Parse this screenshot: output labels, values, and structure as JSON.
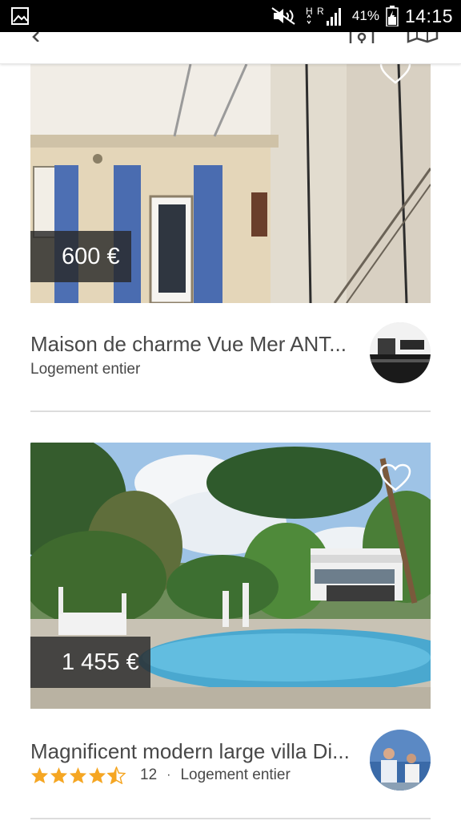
{
  "status_bar": {
    "battery_percent": "41%",
    "time": "14:15",
    "network_label": "H R"
  },
  "app_bar": {
    "icons": [
      "back-icon",
      "filter-icon",
      "map-icon"
    ]
  },
  "listings": [
    {
      "price": "600 €",
      "title": "Maison de charme Vue Mer ANT...",
      "type": "Logement entier",
      "favorited": false
    },
    {
      "price": "1 455 €",
      "title": "Magnificent modern large villa Di...",
      "rating": 4.5,
      "review_count": "12",
      "separator": "·",
      "type": "Logement entier",
      "favorited": false
    }
  ],
  "colors": {
    "star": "#f5a623",
    "price_tag_bg": "#282828",
    "text": "#484848"
  }
}
